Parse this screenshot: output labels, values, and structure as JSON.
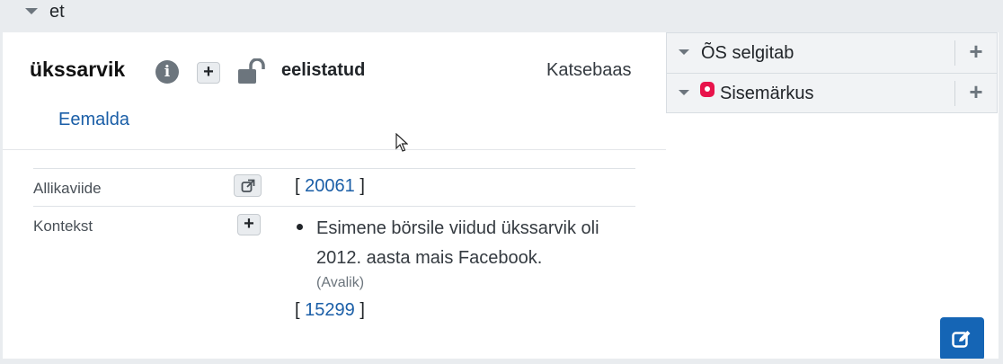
{
  "header": {
    "language": "et"
  },
  "entry": {
    "word": "ükssarvik",
    "preference": "eelistatud",
    "dataset": "Katsebaas",
    "remove_label": "Eemalda"
  },
  "side_panels": [
    {
      "label": "ÕS selgitab"
    },
    {
      "label": "Sisemärkus"
    }
  ],
  "fields": {
    "source_label": "Allikaviide",
    "source_ref": {
      "open": "[",
      "number": "20061",
      "close": "]"
    },
    "context_label": "Kontekst",
    "context_text": "Esimene börsile viidud ükssarvik oli 2012. aasta mais Facebook.",
    "context_visibility": "(Avalik)",
    "context_ref": {
      "open": "[",
      "number": "15299",
      "close": "]"
    }
  },
  "colors": {
    "link": "#1a5ea7",
    "primary_button": "#1565b5",
    "note_badge": "#e8134b"
  },
  "icons": {
    "info": "info-icon",
    "lock": "unlocked-lock-icon",
    "add": "plus-icon",
    "external": "external-link-icon",
    "edit": "edit-icon"
  }
}
